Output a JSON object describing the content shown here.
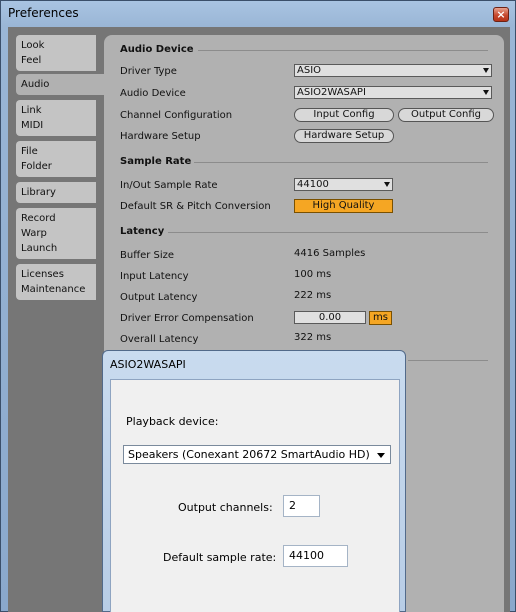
{
  "window": {
    "title": "Preferences",
    "close_glyph": "×"
  },
  "tabs": [
    {
      "lines": [
        "Look",
        "Feel"
      ]
    },
    {
      "lines": [
        "Audio"
      ]
    },
    {
      "lines": [
        "Link",
        "MIDI"
      ]
    },
    {
      "lines": [
        "File",
        "Folder"
      ]
    },
    {
      "lines": [
        "Library"
      ]
    },
    {
      "lines": [
        "Record",
        "Warp",
        "Launch"
      ]
    },
    {
      "lines": [
        "Licenses",
        "Maintenance"
      ]
    }
  ],
  "audio_device": {
    "heading": "Audio Device",
    "driver_type_label": "Driver Type",
    "driver_type_value": "ASIO",
    "audio_device_label": "Audio Device",
    "audio_device_value": "ASIO2WASAPI",
    "channel_config_label": "Channel Configuration",
    "input_config_button": "Input Config",
    "output_config_button": "Output Config",
    "hardware_setup_label": "Hardware Setup",
    "hardware_setup_button": "Hardware Setup"
  },
  "sample_rate": {
    "heading": "Sample Rate",
    "inout_label": "In/Out Sample Rate",
    "inout_value": "44100",
    "default_sr_label": "Default SR & Pitch Conversion",
    "default_sr_value": "High Quality"
  },
  "latency": {
    "heading": "Latency",
    "buffer_size_label": "Buffer Size",
    "buffer_size_value": "4416 Samples",
    "input_latency_label": "Input Latency",
    "input_latency_value": "100 ms",
    "output_latency_label": "Output Latency",
    "output_latency_value": "222 ms",
    "driver_error_label": "Driver Error Compensation",
    "driver_error_value": "0.00",
    "driver_error_unit": "ms",
    "overall_latency_label": "Overall Latency",
    "overall_latency_value": "322 ms"
  },
  "asio_dialog": {
    "title": "ASIO2WASAPI",
    "playback_label": "Playback device:",
    "playback_value": "Speakers (Conexant 20672 SmartAudio HD)",
    "output_channels_label": "Output channels:",
    "output_channels_value": "2",
    "default_rate_label": "Default sample rate:",
    "default_rate_value": "44100"
  },
  "colors": {
    "accent": "#f5a623",
    "panel": "#b1b1b1",
    "background": "#767676"
  }
}
